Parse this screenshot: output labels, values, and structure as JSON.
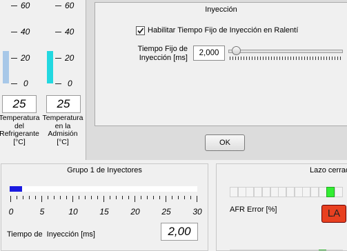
{
  "left_gauges": {
    "scale_labels": [
      "60",
      "40",
      "20",
      "0"
    ],
    "coolant": {
      "value": "25",
      "caption_lines": [
        "Temperatura",
        "del",
        "Refrigerante",
        "[°C]"
      ],
      "level": 25,
      "color": "#a8c8e8"
    },
    "intake": {
      "value": "25",
      "caption_lines": [
        "Temperatura",
        "en la",
        "Admisión",
        "[°C]"
      ],
      "level": 25,
      "color": "#22d8e0"
    }
  },
  "dialog": {
    "title": "Inyección",
    "checkbox_label": "Habilitar Tiempo Fijo de Inyección en Ralentí",
    "checkbox_checked": true,
    "field_label_lines": [
      "Tiempo Fijo de",
      "Inyección [ms]"
    ],
    "field_value": "2,000",
    "slider_fraction": 0.03,
    "ok_label": "OK"
  },
  "injectors": {
    "title": "Grupo 1 de Inyectores",
    "bar_level": 2.0,
    "bar_max": 30,
    "bar_color": "#1a1ae0",
    "axis_labels": [
      "0",
      "5",
      "10",
      "15",
      "20",
      "25",
      "30"
    ],
    "time_label": "Tiempo de  Inyección [ms]",
    "time_value": "2,00"
  },
  "loop": {
    "title": "Lazo cerrado",
    "afr_label": "AFR Error [%]",
    "indicator_text": "LA",
    "indicator_color": "#e84020",
    "led_on_color": "#33ee33"
  }
}
